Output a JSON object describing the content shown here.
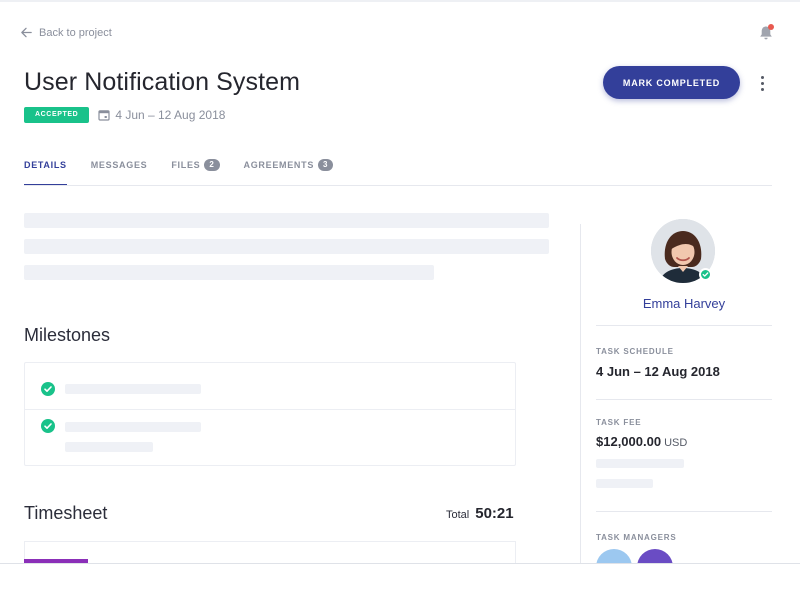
{
  "header": {
    "back_label": "Back to project",
    "title": "User Notification System",
    "status_badge": "ACCEPTED",
    "date_range": "4 Jun – 12 Aug 2018",
    "primary_action": "MARK COMPLETED"
  },
  "tabs": [
    {
      "label": "DETAILS",
      "count": "",
      "active": true
    },
    {
      "label": "MESSAGES",
      "count": "",
      "active": false
    },
    {
      "label": "FILES",
      "count": "2",
      "active": false
    },
    {
      "label": "AGREEMENTS",
      "count": "3",
      "active": false
    }
  ],
  "milestones": {
    "title": "Milestones"
  },
  "timesheet": {
    "title": "Timesheet",
    "total_label": "Total",
    "total_value": "50:21"
  },
  "sidebar": {
    "user_name": "Emma Harvey",
    "schedule_label": "TASK SCHEDULE",
    "schedule_value": "4 Jun – 12 Aug 2018",
    "fee_label": "TASK FEE",
    "fee_value": "$12,000.00",
    "fee_currency": "USD",
    "managers_label": "TASK MANAGERS"
  },
  "colors": {
    "accent": "#333f9a",
    "success": "#19c28a",
    "timesheet_bar": "#8b2fb8",
    "manager_1": "#9cc8f0",
    "manager_2": "#6a4cc4"
  }
}
